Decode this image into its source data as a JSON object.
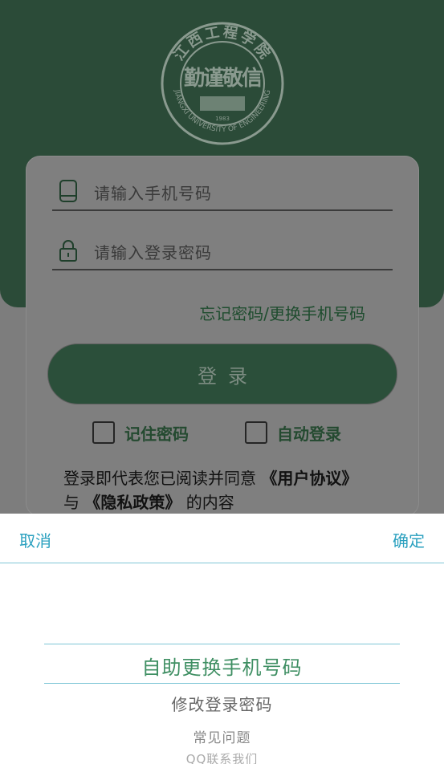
{
  "colors": {
    "header_green": "#2b4b38",
    "accent_cyan": "#2aa0bf",
    "selected_green": "#3f8f63"
  },
  "logo": {
    "arc_text_top": "江西工程学院",
    "arc_text_bottom": "JIANGXI UNIVERSITY OF ENGINEERING",
    "center_chars": "勤谨敬信",
    "year": "1983"
  },
  "login": {
    "phone": {
      "icon": "phone-icon",
      "placeholder": "请输入手机号码"
    },
    "password": {
      "icon": "lock-icon",
      "placeholder": "请输入登录密码"
    },
    "forgot_link": "忘记密码/更换手机号码",
    "login_button": "登录",
    "remember_label": "记住密码",
    "autologin_label": "自动登录",
    "agreement": {
      "prefix": "登录即代表您已阅读并同意 ",
      "user_agreement": "《用户协议》",
      "and": "与 ",
      "privacy": "《隐私政策》",
      "suffix": " 的内容"
    }
  },
  "picker": {
    "cancel": "取消",
    "confirm": "确定",
    "options": [
      "自助更换手机号码",
      "修改登录密码",
      "常见问题",
      "QQ联系我们"
    ],
    "selected_index": 0
  }
}
